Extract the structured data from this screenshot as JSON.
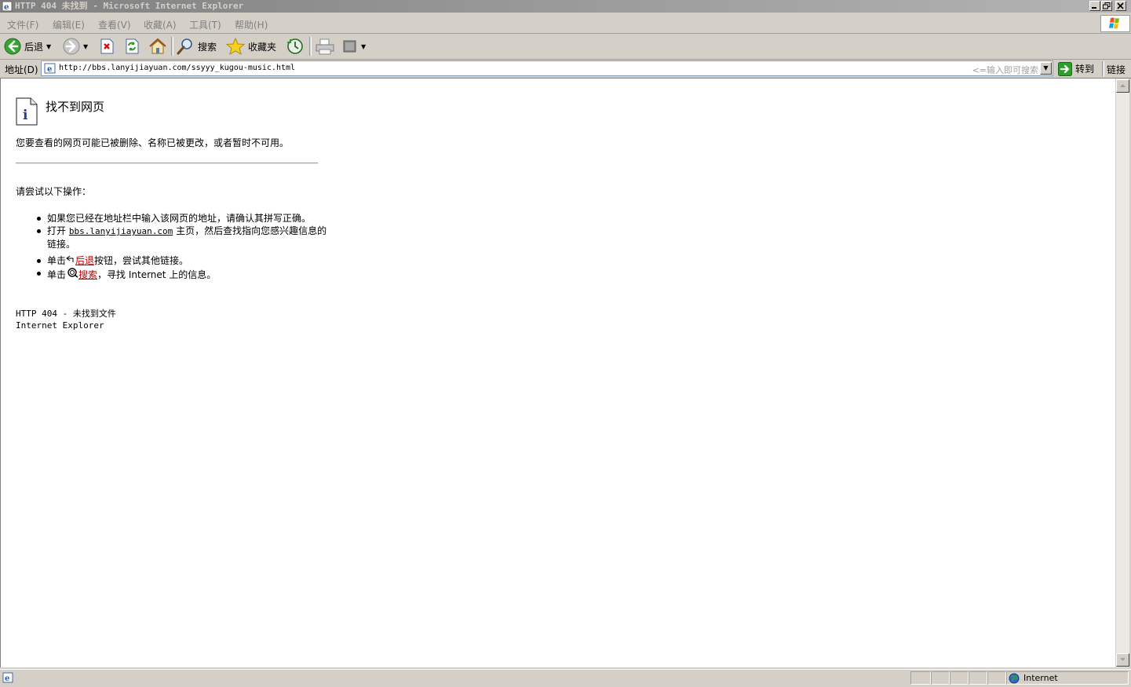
{
  "window": {
    "title": "HTTP 404 未找到 - Microsoft Internet Explorer"
  },
  "menu": {
    "items": [
      "文件(F)",
      "编辑(E)",
      "查看(V)",
      "收藏(A)",
      "工具(T)",
      "帮助(H)"
    ]
  },
  "toolbar": {
    "back_label": "后退",
    "search_label": "搜索",
    "favorites_label": "收藏夹"
  },
  "address": {
    "label": "地址(D)",
    "url": "http://bbs.lanyijiayuan.com/ssyyy_kugou-music.html",
    "search_hint": "<=输入即可搜索",
    "go_label": "转到",
    "links_label": "链接"
  },
  "page": {
    "title": "找不到网页",
    "description": "您要查看的网页可能已被删除、名称已被更改，或者暂时不可用。",
    "try_heading": "请尝试以下操作：",
    "bullet1": "如果您已经在地址栏中输入该网页的地址，请确认其拼写正确。",
    "bullet2_pre": "打开",
    "bullet2_link": "bbs.lanyijiayuan.com",
    "bullet2_post": "主页，然后查找指向您感兴趣信息的链接。",
    "bullet3_pre": "单击",
    "bullet3_link": "后退",
    "bullet3_post": "按钮，尝试其他链接。",
    "bullet4_pre": "单击",
    "bullet4_link": "搜索",
    "bullet4_post": "，寻找 Internet 上的信息。",
    "error_code": "HTTP 404 - 未找到文件",
    "browser_name": "Internet Explorer"
  },
  "status": {
    "zone": "Internet"
  }
}
